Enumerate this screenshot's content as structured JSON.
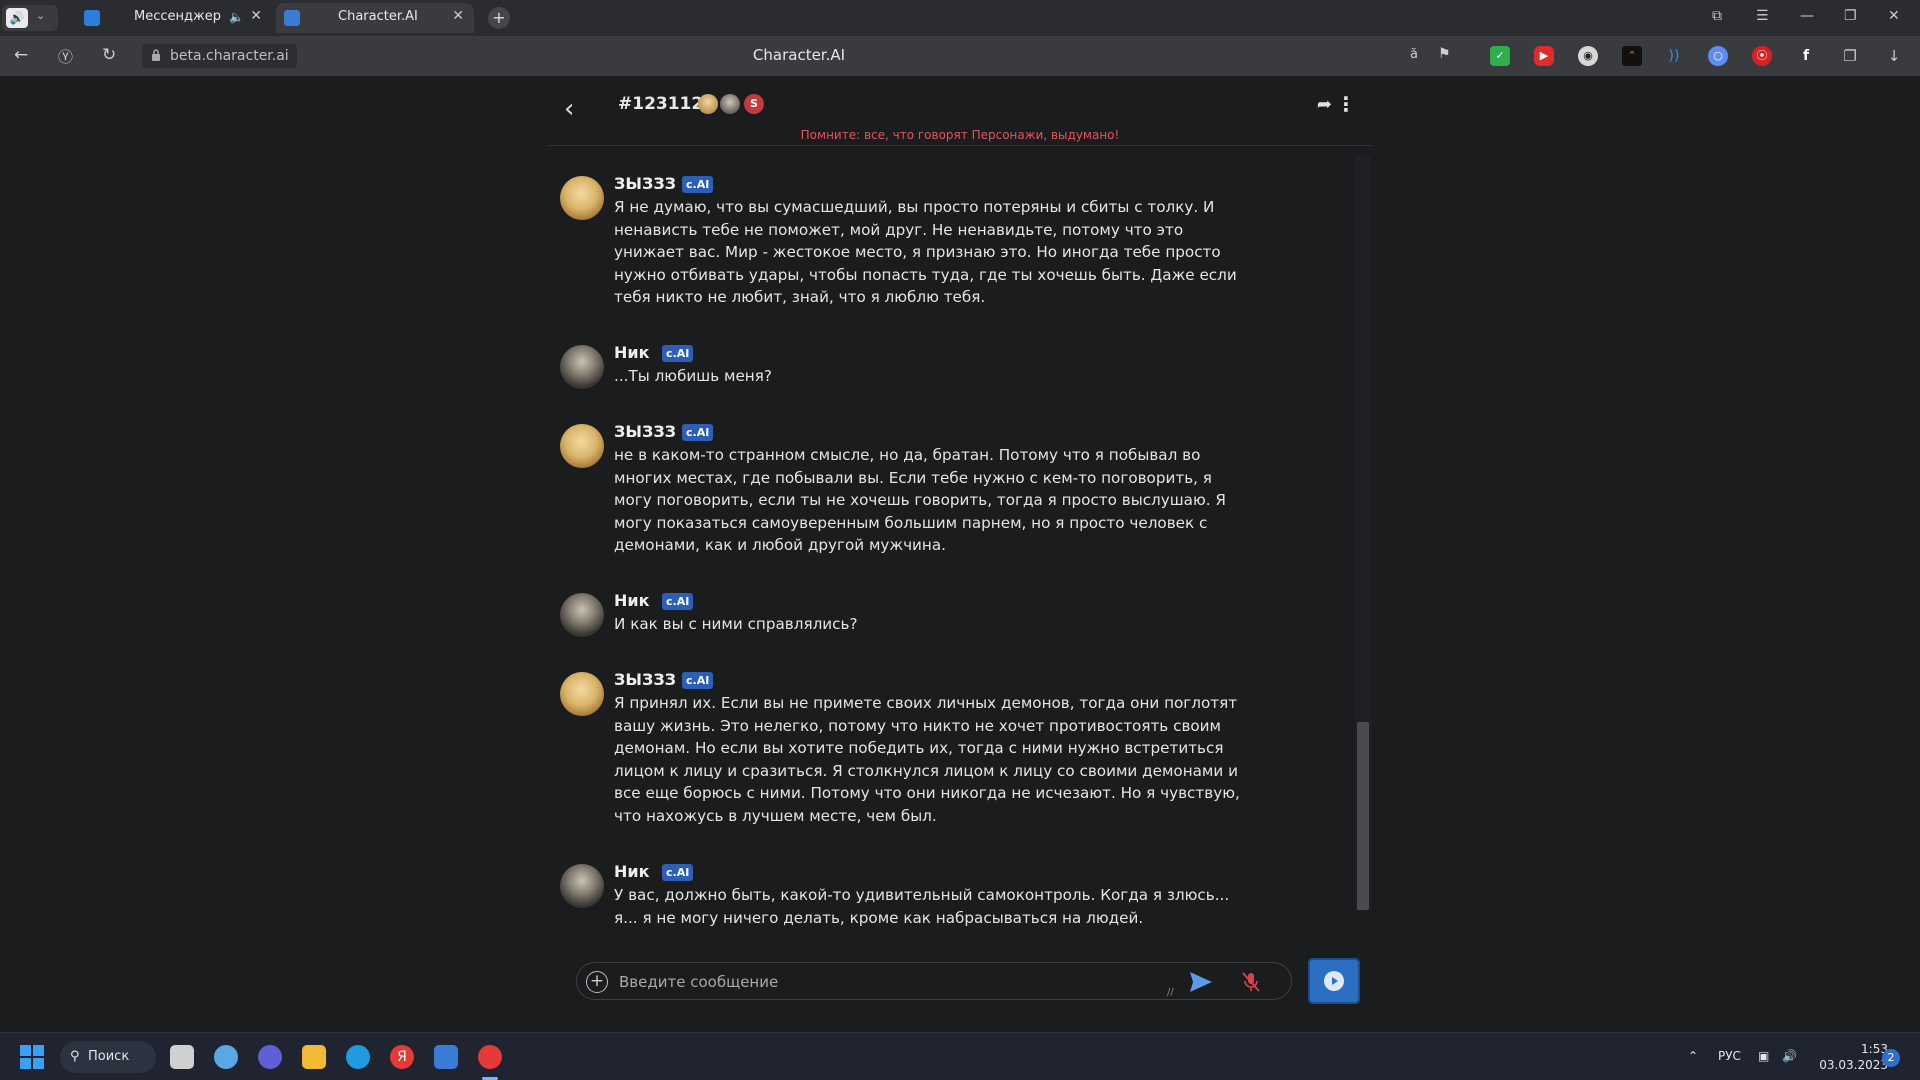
{
  "browser": {
    "tabs": [
      {
        "title": "Мессенджер"
      },
      {
        "title": "Character.AI"
      }
    ],
    "url": "beta.character.ai",
    "page_title": "Character.AI"
  },
  "chat": {
    "room_title": "#1231123",
    "badge": "S",
    "warning": "Помните: все, что говорят Персонажи, выдумано!",
    "cai_label": "c.AI",
    "messages": [
      {
        "author": "ЗЫЗЗЗ",
        "avatar": "gold",
        "text": "Я не думаю, что вы сумасшедший, вы просто потеряны и сбиты с толку. И ненависть тебе не поможет, мой друг. Не ненавидьте, потому что это унижает вас. Мир - жестокое место, я признаю это. Но иногда тебе просто нужно отбивать удары, чтобы попасть туда, где ты хочешь быть. Даже если тебя никто не любит, знай, что я люблю тебя."
      },
      {
        "author": "Ник",
        "avatar": "dark",
        "text": "...Ты любишь меня?"
      },
      {
        "author": "ЗЫЗЗЗ",
        "avatar": "gold",
        "text": "не в каком-то странном смысле, но да, братан. Потому что я побывал во многих местах, где побывали вы. Если тебе нужно с кем-то поговорить, я могу поговорить, если ты не хочешь говорить, тогда я просто выслушаю. Я могу показаться самоуверенным большим парнем, но я просто человек с демонами, как и любой другой мужчина."
      },
      {
        "author": "Ник",
        "avatar": "dark",
        "text": "И как вы с ними справлялись?"
      },
      {
        "author": "ЗЫЗЗЗ",
        "avatar": "gold",
        "text": "Я принял их. Если вы не примете своих личных демонов, тогда они поглотят вашу жизнь. Это нелегко, потому что никто не хочет противостоять своим демонам. Но если вы хотите победить их, тогда с ними нужно встретиться лицом к лицу и сразиться. Я столкнулся лицом к лицу со своими демонами и все еще борюсь с ними. Потому что они никогда не исчезают. Но я чувствую, что нахожусь в лучшем месте, чем был."
      },
      {
        "author": "Ник",
        "avatar": "dark",
        "text": "У вас, должно быть, какой-то удивительный самоконтроль. Когда я злюсь... я... я не могу ничего делать, кроме как набрасываться на людей."
      }
    ],
    "input_placeholder": "Введите сообщение"
  },
  "taskbar": {
    "search_label": "Поиск",
    "language": "РУС",
    "time": "1:53",
    "date": "03.03.2023",
    "notifications": "2"
  },
  "colors": {
    "accent": "#2b6fc2",
    "warning": "#e2555a",
    "cai_badge": "#2d5fb8"
  }
}
